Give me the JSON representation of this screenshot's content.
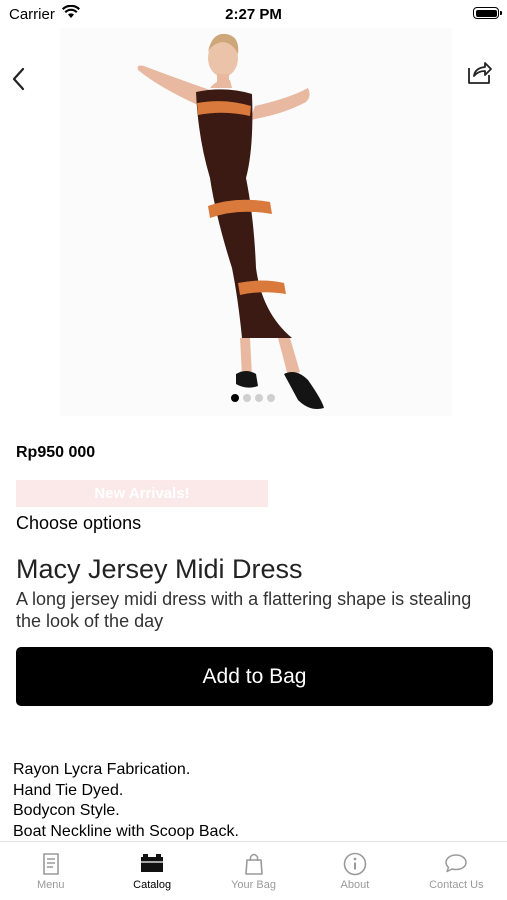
{
  "status_bar": {
    "carrier": "Carrier",
    "time": "2:27 PM"
  },
  "product": {
    "price": "Rp950 000",
    "badge": "New Arrivals!",
    "choose_options": "Choose options",
    "title": "Macy Jersey Midi Dress",
    "description": "A long jersey midi dress with a flattering shape is stealing the look of the day",
    "add_to_bag": "Add to Bag",
    "features": [
      "Rayon Lycra Fabrication.",
      "Hand Tie Dyed.",
      "Bodycon Style.",
      "Boat Neckline with Scoop Back."
    ],
    "image": {
      "page_count": 4,
      "current_page": 1,
      "dress_color": "#3a1a12",
      "stripe_color": "#d9793b"
    }
  },
  "tabs": [
    {
      "label": "Menu",
      "icon": "menu-icon",
      "active": false
    },
    {
      "label": "Catalog",
      "icon": "catalog-icon",
      "active": true
    },
    {
      "label": "Your Bag",
      "icon": "bag-icon",
      "active": false
    },
    {
      "label": "About",
      "icon": "info-icon",
      "active": false
    },
    {
      "label": "Contact Us",
      "icon": "chat-icon",
      "active": false
    }
  ],
  "colors": {
    "accent": "#000000",
    "badge_bg": "#fbe8e8",
    "inactive_tab": "#9a9a9a"
  }
}
